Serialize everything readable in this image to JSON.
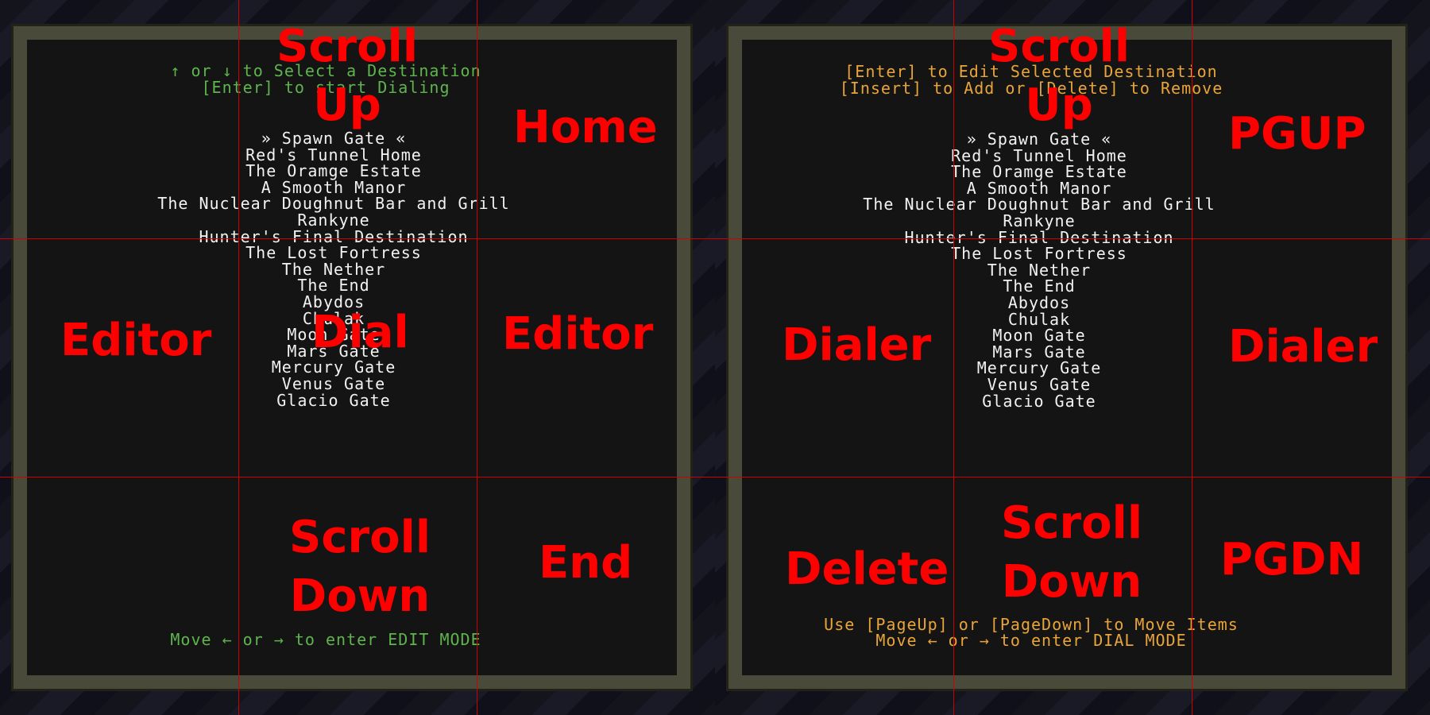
{
  "left_panel": {
    "header_lines": [
      "↑ or ↓ to Select a Destination",
      "[Enter] to start Dialing"
    ],
    "footer_lines": [
      "Move ← or → to enter EDIT MODE"
    ],
    "zones": {
      "top_center": [
        "Scroll",
        "Up"
      ],
      "top_right": "Home",
      "mid_left": "Editor",
      "mid_center": "Dial",
      "mid_right": "Editor",
      "bottom_center": [
        "Scroll",
        "Down"
      ],
      "bottom_right": "End"
    }
  },
  "right_panel": {
    "header_lines": [
      "[Enter] to Edit Selected Destination",
      "[Insert] to Add or [Delete] to Remove"
    ],
    "footer_lines": [
      "Use [PageUp] or [PageDown] to Move Items",
      "Move ← or → to enter DIAL MODE"
    ],
    "zones": {
      "top_center": [
        "Scroll",
        "Up"
      ],
      "top_right": "PGUP",
      "mid_left": "Dialer",
      "mid_right": "Dialer",
      "bottom_left": "Delete",
      "bottom_center": [
        "Scroll",
        "Down"
      ],
      "bottom_right": "PGDN"
    }
  },
  "destinations": [
    "» Spawn Gate «",
    "Red's Tunnel Home",
    "The Oramge Estate",
    "A Smooth Manor",
    "The Nuclear Doughnut Bar and Grill",
    "Rankyne",
    "Hunter's Final Destination",
    "The Lost Fortress",
    "The Nether",
    "The End",
    "Abydos",
    "Chulak",
    "Moon Gate",
    "Mars Gate",
    "Mercury Gate",
    "Venus Gate",
    "Glacio Gate"
  ],
  "colors": {
    "hint_green": "#5fb44e",
    "hint_orange": "#e9a43a",
    "list_white": "#f2f2f2",
    "overlay_red": "#ff0000",
    "grid_red": "#d10000",
    "screen_bg": "#141414"
  }
}
